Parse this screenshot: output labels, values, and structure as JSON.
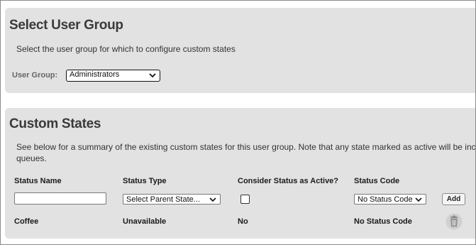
{
  "select_group": {
    "title": "Select User Group",
    "description": "Select the user group for which to configure custom states",
    "label": "User Group:",
    "selected": "Administrators"
  },
  "custom_states": {
    "title": "Custom States",
    "description": "See below for a summary of the existing custom states for this user group. Note that any state marked as active will be inc queues.",
    "columns": {
      "status_name": "Status Name",
      "status_type": "Status Type",
      "active": "Consider Status as Active?",
      "status_code": "Status Code"
    },
    "new_row": {
      "name_value": "",
      "parent_state": "Select Parent State...",
      "active_checked": false,
      "status_code": "No Status Code",
      "add_label": "Add"
    },
    "rows": [
      {
        "name": "Coffee",
        "type": "Unavailable",
        "active": "No",
        "code": "No Status Code"
      }
    ]
  },
  "icons": {
    "dropdown": "chevron-down-icon",
    "delete": "trash-icon"
  }
}
